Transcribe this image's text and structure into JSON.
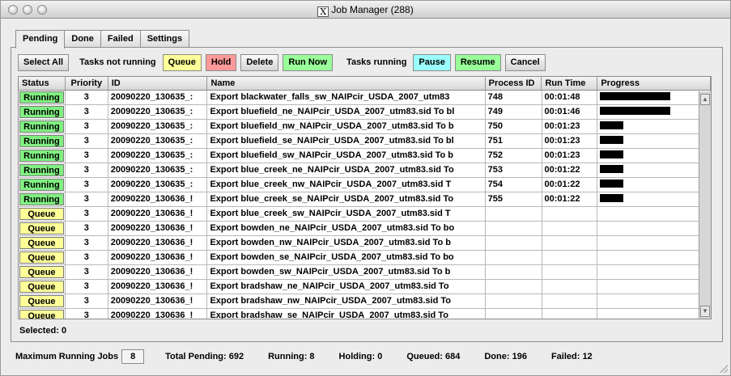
{
  "window": {
    "title": "Job Manager (288)",
    "title_icon": "x11-icon"
  },
  "tabs": [
    {
      "label": "Pending",
      "active": true
    },
    {
      "label": "Done",
      "active": false
    },
    {
      "label": "Failed",
      "active": false
    },
    {
      "label": "Settings",
      "active": false
    }
  ],
  "toolbar": {
    "select_all": "Select All",
    "not_running_label": "Tasks not running",
    "queue": "Queue",
    "hold": "Hold",
    "delete": "Delete",
    "run_now": "Run Now",
    "running_label": "Tasks running",
    "pause": "Pause",
    "resume": "Resume",
    "cancel": "Cancel"
  },
  "colors": {
    "queue_btn": "#ffff99",
    "hold_btn": "#ff9999",
    "run_now_btn": "#99ff99",
    "pause_btn": "#99ffff",
    "resume_btn": "#99ff99",
    "status_running": "#80f080",
    "status_queue": "#ffff99"
  },
  "table": {
    "columns": [
      "Status",
      "Priority",
      "ID",
      "Name",
      "Process ID",
      "Run Time",
      "Progress"
    ],
    "rows": [
      {
        "status": "Running",
        "priority": "3",
        "id": "20090220_130635_:",
        "name": "Export blackwater_falls_sw_NAIPcir_USDA_2007_utm83",
        "pid": "748",
        "runtime": "00:01:48",
        "progress": 0.62
      },
      {
        "status": "Running",
        "priority": "3",
        "id": "20090220_130635_:",
        "name": "Export bluefield_ne_NAIPcir_USDA_2007_utm83.sid To bl",
        "pid": "749",
        "runtime": "00:01:46",
        "progress": 0.62
      },
      {
        "status": "Running",
        "priority": "3",
        "id": "20090220_130635_:",
        "name": "Export bluefield_nw_NAIPcir_USDA_2007_utm83.sid To b",
        "pid": "750",
        "runtime": "00:01:23",
        "progress": 0.21
      },
      {
        "status": "Running",
        "priority": "3",
        "id": "20090220_130635_:",
        "name": "Export bluefield_se_NAIPcir_USDA_2007_utm83.sid To bl",
        "pid": "751",
        "runtime": "00:01:23",
        "progress": 0.21
      },
      {
        "status": "Running",
        "priority": "3",
        "id": "20090220_130635_:",
        "name": "Export bluefield_sw_NAIPcir_USDA_2007_utm83.sid To b",
        "pid": "752",
        "runtime": "00:01:23",
        "progress": 0.21
      },
      {
        "status": "Running",
        "priority": "3",
        "id": "20090220_130635_:",
        "name": "Export blue_creek_ne_NAIPcir_USDA_2007_utm83.sid To",
        "pid": "753",
        "runtime": "00:01:22",
        "progress": 0.21
      },
      {
        "status": "Running",
        "priority": "3",
        "id": "20090220_130635_:",
        "name": "Export blue_creek_nw_NAIPcir_USDA_2007_utm83.sid T",
        "pid": "754",
        "runtime": "00:01:22",
        "progress": 0.21
      },
      {
        "status": "Running",
        "priority": "3",
        "id": "20090220_130636_!",
        "name": "Export blue_creek_se_NAIPcir_USDA_2007_utm83.sid To",
        "pid": "755",
        "runtime": "00:01:22",
        "progress": 0.21
      },
      {
        "status": "Queue",
        "priority": "3",
        "id": "20090220_130636_!",
        "name": "Export blue_creek_sw_NAIPcir_USDA_2007_utm83.sid T",
        "pid": "",
        "runtime": "",
        "progress": 0
      },
      {
        "status": "Queue",
        "priority": "3",
        "id": "20090220_130636_!",
        "name": "Export bowden_ne_NAIPcir_USDA_2007_utm83.sid To bo",
        "pid": "",
        "runtime": "",
        "progress": 0
      },
      {
        "status": "Queue",
        "priority": "3",
        "id": "20090220_130636_!",
        "name": "Export bowden_nw_NAIPcir_USDA_2007_utm83.sid To b",
        "pid": "",
        "runtime": "",
        "progress": 0
      },
      {
        "status": "Queue",
        "priority": "3",
        "id": "20090220_130636_!",
        "name": "Export bowden_se_NAIPcir_USDA_2007_utm83.sid To bo",
        "pid": "",
        "runtime": "",
        "progress": 0
      },
      {
        "status": "Queue",
        "priority": "3",
        "id": "20090220_130636_!",
        "name": "Export bowden_sw_NAIPcir_USDA_2007_utm83.sid To b",
        "pid": "",
        "runtime": "",
        "progress": 0
      },
      {
        "status": "Queue",
        "priority": "3",
        "id": "20090220_130636_!",
        "name": "Export bradshaw_ne_NAIPcir_USDA_2007_utm83.sid To",
        "pid": "",
        "runtime": "",
        "progress": 0
      },
      {
        "status": "Queue",
        "priority": "3",
        "id": "20090220_130636_!",
        "name": "Export bradshaw_nw_NAIPcir_USDA_2007_utm83.sid To",
        "pid": "",
        "runtime": "",
        "progress": 0
      },
      {
        "status": "Queue",
        "priority": "3",
        "id": "20090220_130636_!",
        "name": "Export bradshaw_se_NAIPcir_USDA_2007_utm83.sid To",
        "pid": "",
        "runtime": "",
        "progress": 0
      }
    ]
  },
  "selected_text": "Selected: 0",
  "statusbar": {
    "max_running_label": "Maximum Running Jobs",
    "max_running_value": "8",
    "total_pending": "Total Pending: 692",
    "running": "Running: 8",
    "holding": "Holding: 0",
    "queued": "Queued: 684",
    "done": "Done: 196",
    "failed": "Failed: 12"
  }
}
